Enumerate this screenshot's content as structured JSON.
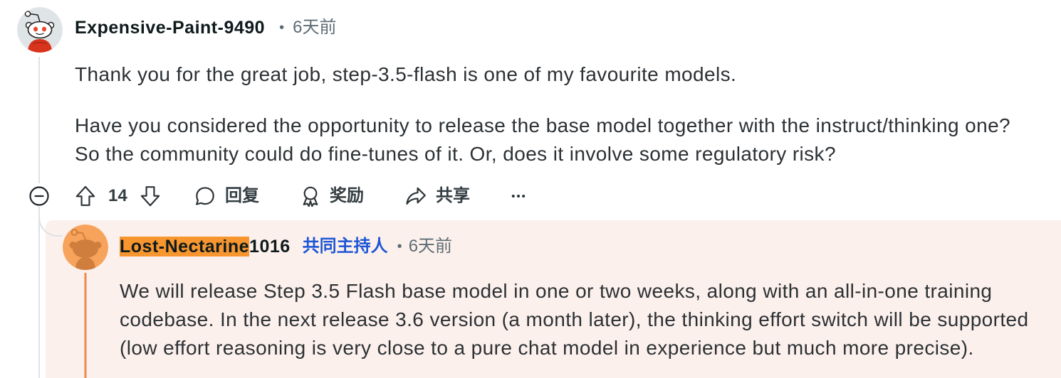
{
  "thread": {
    "comment": {
      "author": "Expensive-Paint-9490",
      "separator": "•",
      "time": "6天前",
      "avatar_icon": "snoo-avatar-icon",
      "paragraphs": [
        "Thank you for the great job, step-3.5-flash is one of my favourite models.",
        "Have you considered the opportunity to release the base model together with the instruct/thinking one? So the community could do fine-tunes of it. Or, does it involve some regulatory risk?"
      ],
      "actions": {
        "collapse_icon": "minus-circle-icon",
        "upvote_icon": "arrow-up-outline-icon",
        "score": "14",
        "downvote_icon": "arrow-down-outline-icon",
        "reply_icon": "speech-bubble-icon",
        "reply_label": "回复",
        "award_icon": "award-medal-icon",
        "award_label": "奖励",
        "share_icon": "share-arrow-icon",
        "share_label": "共享",
        "more_icon": "ellipsis-icon"
      }
    },
    "reply": {
      "author_highlight": "Lost-Nectarine",
      "author_rest": "1016",
      "role_badge": "共同主持人",
      "separator": "•",
      "time": "6天前",
      "avatar_icon": "snoo-avatar-icon",
      "paragraphs": [
        "We will release Step 3.5 Flash base model in one or two weeks, along with an all-in-one training codebase. In the next release 3.6 version (a month later), the thinking effort switch will be supported (low effort reasoning is very close to a pure chat model in experience but much more precise)."
      ]
    }
  },
  "colors": {
    "highlight_background": "#fcf0ec",
    "name_search_highlight": "#f7962f",
    "moderator_blue": "#1d56d5",
    "reply_thread_line": "#ec8a4c",
    "thread_line_gray": "#dde2e5"
  }
}
